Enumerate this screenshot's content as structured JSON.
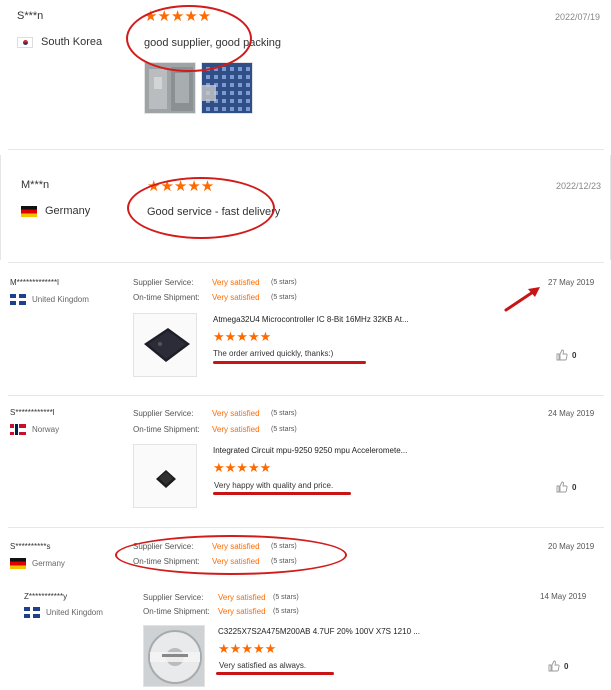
{
  "reviews_top": [
    {
      "name": "S***n",
      "country": "South Korea",
      "flag": "kr",
      "date": "2022/07/19",
      "comment": "good supplier, good packing"
    },
    {
      "name": "M***n",
      "country": "Germany",
      "flag": "de",
      "date": "2022/12/23",
      "comment": "Good service - fast delivery"
    }
  ],
  "stars_glyph": "★★★★★",
  "labels": {
    "supplier_service": "Supplier Service:",
    "ontime_shipment": "On-time Shipment:",
    "very_satisfied": "Very satisfied",
    "five_stars": "(5 stars)"
  },
  "reviews_bottom": [
    {
      "name": "M*************l",
      "country": "United Kingdom",
      "flag": "uk",
      "date": "27 May 2019",
      "product": "Atmega32U4 Microcontroller IC 8-Bit 16MHz 32KB At...",
      "comment": "The order arrived quickly, thanks:)",
      "likes": "0"
    },
    {
      "name": "S************l",
      "country": "Norway",
      "flag": "no",
      "date": "24 May 2019",
      "product": "Integrated Circuit mpu-9250 9250 mpu Acceleromete...",
      "comment": "Very happy with quality and price.",
      "likes": "0"
    },
    {
      "name": "S**********s",
      "country": "Germany",
      "flag": "de",
      "date": "20 May 2019"
    },
    {
      "name": "Z***********y",
      "country": "United Kingdom",
      "flag": "uk",
      "date": "14 May 2019",
      "product": "C3225X7S2A475M200AB 4.7UF 20% 100V X7S 1210 ...",
      "comment": "Very satisfied as always.",
      "likes": "0"
    }
  ],
  "colors": {
    "accent": "#ff6a00",
    "annotation_red": "#d21c1c"
  },
  "icons": [
    "flag-icon",
    "thumbs-up-icon",
    "star-icon",
    "arrow-annotation-icon"
  ]
}
